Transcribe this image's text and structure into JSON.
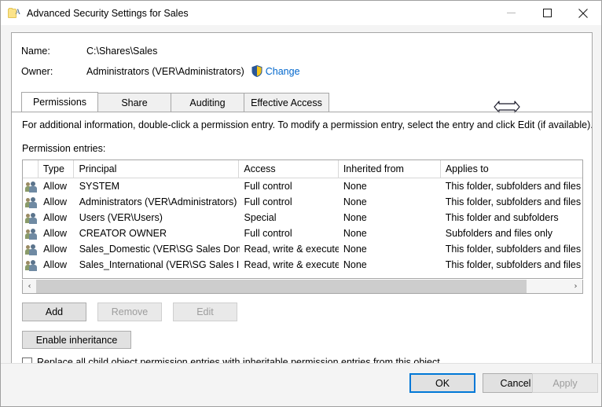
{
  "window": {
    "title": "Advanced Security Settings for Sales",
    "icon": "folder-icon",
    "controls": {
      "minimize": "minimize-icon",
      "maximize": "maximize-icon",
      "close": "close-icon"
    }
  },
  "header": {
    "name_label": "Name:",
    "name_value": "C:\\Shares\\Sales",
    "owner_label": "Owner:",
    "owner_value": "Administrators (VER\\Administrators)",
    "change_link": "Change",
    "shield_icon": "uac-shield-icon"
  },
  "cursor": {
    "type": "horizontal-resize-cursor"
  },
  "tabs": [
    {
      "label": "Permissions",
      "active": true
    },
    {
      "label": "Share",
      "active": false
    },
    {
      "label": "Auditing",
      "active": false
    },
    {
      "label": "Effective Access",
      "active": false
    }
  ],
  "main": {
    "info_text": "For additional information, double-click a permission entry. To modify a permission entry, select the entry and click Edit (if available).",
    "entries_label": "Permission entries:"
  },
  "grid": {
    "columns": [
      "",
      "Type",
      "Principal",
      "Access",
      "Inherited from",
      "Applies to"
    ],
    "rows": [
      {
        "icon": "users-group-icon",
        "type": "Allow",
        "principal": "SYSTEM",
        "access": "Full control",
        "inherited_from": "None",
        "applies_to": "This folder, subfolders and files"
      },
      {
        "icon": "users-group-icon",
        "type": "Allow",
        "principal": "Administrators (VER\\Administrators)",
        "access": "Full control",
        "inherited_from": "None",
        "applies_to": "This folder, subfolders and files"
      },
      {
        "icon": "users-group-icon",
        "type": "Allow",
        "principal": "Users (VER\\Users)",
        "access": "Special",
        "inherited_from": "None",
        "applies_to": "This folder and subfolders"
      },
      {
        "icon": "users-group-icon",
        "type": "Allow",
        "principal": "CREATOR OWNER",
        "access": "Full control",
        "inherited_from": "None",
        "applies_to": "Subfolders and files only"
      },
      {
        "icon": "users-group-icon",
        "type": "Allow",
        "principal": "Sales_Domestic (VER\\SG Sales Domestic)",
        "access": "Read, write & execute",
        "inherited_from": "None",
        "applies_to": "This folder, subfolders and files"
      },
      {
        "icon": "users-group-icon",
        "type": "Allow",
        "principal": "Sales_International (VER\\SG Sales Intern...",
        "access": "Read, write & execute",
        "inherited_from": "None",
        "applies_to": "This folder, subfolders and files"
      }
    ]
  },
  "scrollbar": {
    "left_arrow": "‹",
    "right_arrow": "›",
    "thumb_percent": 92
  },
  "actions": {
    "add": "Add",
    "remove": "Remove",
    "edit": "Edit",
    "enable_inheritance": "Enable inheritance",
    "remove_disabled": true,
    "edit_disabled": true
  },
  "replace_option": {
    "label": "Replace all child object permission entries with inheritable permission entries from this object",
    "checked": false
  },
  "footer": {
    "ok": "OK",
    "cancel": "Cancel",
    "apply": "Apply",
    "apply_disabled": true
  },
  "colors": {
    "link": "#0066cc",
    "focus_border": "#0078d7",
    "dialog_bg": "#f4f4f4",
    "panel_bg": "#ffffff",
    "disabled_text": "#9d9d9d"
  }
}
